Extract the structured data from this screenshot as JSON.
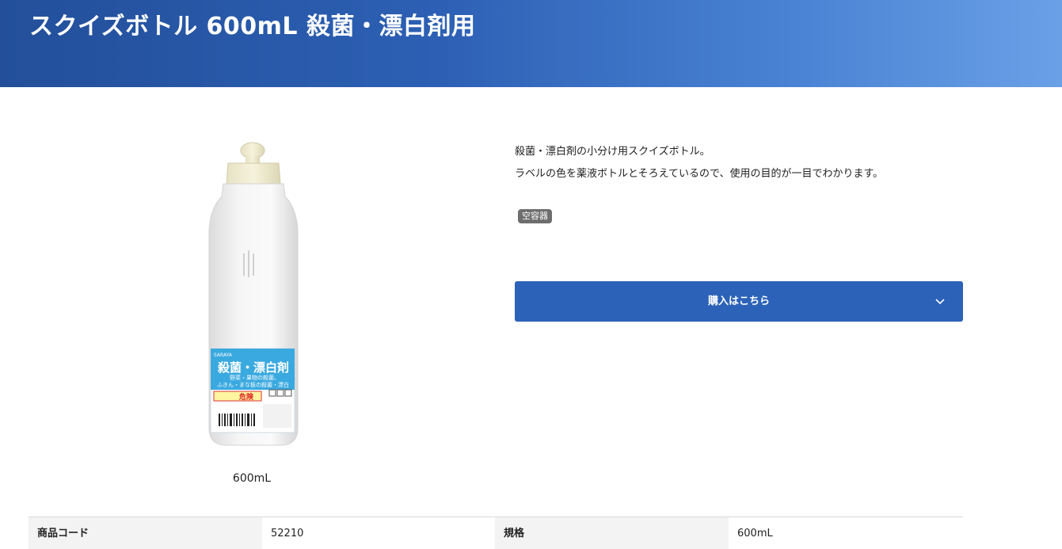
{
  "header": {
    "title": "スクイズボトル 600mL 殺菌・漂白剤用"
  },
  "product": {
    "image_alt": "スクイズボトル",
    "caption": "600mL",
    "label": {
      "brand": "SARAYA",
      "main": "殺菌・漂白剤",
      "sub1": "野菜・果物の殺菌、",
      "sub2": "ふきん・まな板の殺菌・漂白",
      "warning": "危険"
    }
  },
  "description": {
    "line1": "殺菌・漂白剤の小分け用スクイズボトル。",
    "line2": "ラベルの色を薬液ボトルとそろえているので、使用の目的が一目でわかります。"
  },
  "tag": "空容器",
  "buy_button": {
    "label": "購入はこちら",
    "icon": "chevron-down-icon"
  },
  "spec": {
    "code_label": "商品コード",
    "code_value": "52210",
    "size_label": "規格",
    "size_value": "600mL"
  },
  "colors": {
    "header_start": "#234f9a",
    "header_end": "#6aa0e6",
    "button": "#2c62b7",
    "bottle_label": "#3aa9e0"
  }
}
